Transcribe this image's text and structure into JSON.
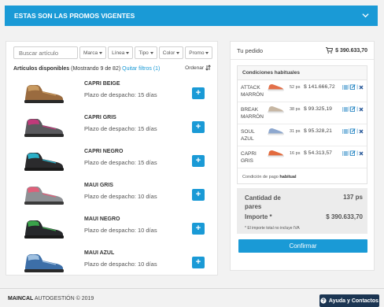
{
  "banner": {
    "title": "ESTAS SON LAS PROMOS VIGENTES"
  },
  "toolbar": {
    "search_placeholder": "Buscar artículo",
    "filters": [
      "Marca",
      "Línea",
      "Tipo",
      "Color",
      "Promo"
    ],
    "order_label": "Ordenar"
  },
  "results": {
    "label": "Artículos disponibles",
    "showing": "(Mostrando 9 de 82)",
    "clear_filters": "Quitar filtros (1)"
  },
  "products": [
    {
      "name": "CAPRI BEIGE",
      "lead_time": "Plazo de despacho: 15 días",
      "add_label": "+",
      "body_color": "#9a6b3f",
      "sole_color": "#2a2a2a",
      "accent_color": "#c89a60"
    },
    {
      "name": "CAPRI GRIS",
      "lead_time": "Plazo de despacho: 15 días",
      "add_label": "+",
      "body_color": "#5a5a5e",
      "sole_color": "#2a2a2a",
      "accent_color": "#c0397a"
    },
    {
      "name": "CAPRI NEGRO",
      "lead_time": "Plazo de despacho: 15 días",
      "add_label": "+",
      "body_color": "#2b2b2d",
      "sole_color": "#1a1a1a",
      "accent_color": "#2bb0c8"
    },
    {
      "name": "MAUI GRIS",
      "lead_time": "Plazo de despacho: 10 días",
      "add_label": "+",
      "body_color": "#8e9094",
      "sole_color": "#3a3a3a",
      "accent_color": "#e0607a"
    },
    {
      "name": "MAUI NEGRO",
      "lead_time": "Plazo de despacho: 10 días",
      "add_label": "+",
      "body_color": "#26282b",
      "sole_color": "#1a1a1a",
      "accent_color": "#3aa34a"
    },
    {
      "name": "MAUI AZUL",
      "lead_time": "Plazo de despacho: 10 días",
      "add_label": "+",
      "body_color": "#3d6fa8",
      "sole_color": "#2a2a2a",
      "accent_color": "#9fc0e0"
    }
  ],
  "order": {
    "title": "Tu pedido",
    "total": "$ 390.633,70",
    "conditions_title": "Condiciones habituales",
    "lines": [
      {
        "name": "ATTACK MARRÓN",
        "qty": "52 ps",
        "price": "$ 141.666,72",
        "shoe_color": "#e3704a"
      },
      {
        "name": "BREAK MARRÓN",
        "qty": "38 ps",
        "price": "$ 99.325,19",
        "shoe_color": "#c7b7a3"
      },
      {
        "name": "SOUL AZUL",
        "qty": "31 ps",
        "price": "$ 95.328,21",
        "shoe_color": "#8ea8cf"
      },
      {
        "name": "CAPRI GRIS",
        "qty": "16 ps",
        "price": "$ 54.313,57",
        "shoe_color": "#e36b3e"
      }
    ],
    "payment_label": "Condición de pago",
    "payment_value": "habitual",
    "qty_label": "Cantidad de pares",
    "qty_value": "137 ps",
    "amount_label": "Importe *",
    "amount_value": "$ 390.633,70",
    "tax_note": "* El importe total no incluye IVA",
    "confirm_label": "Confirmar"
  },
  "footer": {
    "brand": "MAINCAL",
    "text": "AUTOGESTIÓN © 2019",
    "help_label": "Ayuda y Contactos"
  },
  "colors": {
    "accent": "#1a9ad6",
    "help_button": "#1b3552"
  }
}
